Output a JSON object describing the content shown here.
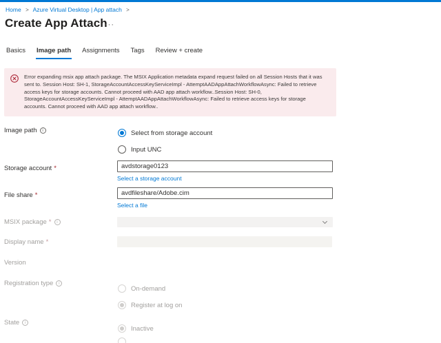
{
  "colors": {
    "accent": "#0078d4",
    "topbar": "#0078d4",
    "error_background": "#faebed",
    "error_icon": "#ae2c3c",
    "disabled_text": "#a19f9d"
  },
  "icons": {
    "info": "i",
    "error": "circle-x",
    "chevron_down": "chevron-down",
    "more": "···"
  },
  "ui": {
    "required_mark": "*"
  },
  "breadcrumb": {
    "separator": ">",
    "items": [
      {
        "label": "Home"
      },
      {
        "label": "Azure Virtual Desktop | App attach"
      }
    ]
  },
  "header": {
    "title": "Create App Attach"
  },
  "tabs": [
    {
      "label": "Basics",
      "active": false
    },
    {
      "label": "Image path",
      "active": true
    },
    {
      "label": "Assignments",
      "active": false
    },
    {
      "label": "Tags",
      "active": false
    },
    {
      "label": "Review + create",
      "active": false
    }
  ],
  "error": {
    "text": "Error expanding msix app attach package. The MSIX Application metadata expand request failed on all Session Hosts that it was sent to. Session Host: SH-1, StorageAccountAccessKeyServiceImpl - AttemptAADAppAttachWorkflowAsync: Failed to retrieve access keys for storage accounts. Cannot proceed with AAD app attach workflow..Session Host: SH-0, StorageAccountAccessKeyServiceImpl - AttemptAADAppAttachWorkflowAsync: Failed to retrieve access keys for storage accounts. Cannot proceed with AAD app attach workflow.."
  },
  "form": {
    "image_path": {
      "label": "Image path",
      "options": [
        {
          "label": "Select from storage account",
          "selected": true
        },
        {
          "label": "Input UNC",
          "selected": false
        }
      ]
    },
    "storage_account": {
      "label": "Storage account",
      "value": "avdstorage0123",
      "link": "Select a storage account"
    },
    "file_share": {
      "label": "File share",
      "value": "avdfileshare/Adobe.cim",
      "link": "Select a file"
    },
    "msix_package": {
      "label": "MSIX package",
      "value": "",
      "disabled": true
    },
    "display_name": {
      "label": "Display name",
      "value": "",
      "disabled": true
    },
    "version": {
      "label": "Version"
    },
    "registration_type": {
      "label": "Registration type",
      "disabled": true,
      "options": [
        {
          "label": "On-demand",
          "selected": false
        },
        {
          "label": "Register at log on",
          "selected": true
        }
      ]
    },
    "state": {
      "label": "State",
      "disabled": true,
      "options": [
        {
          "label": "Inactive",
          "selected": true
        },
        {
          "label": "",
          "selected": false
        }
      ]
    }
  }
}
